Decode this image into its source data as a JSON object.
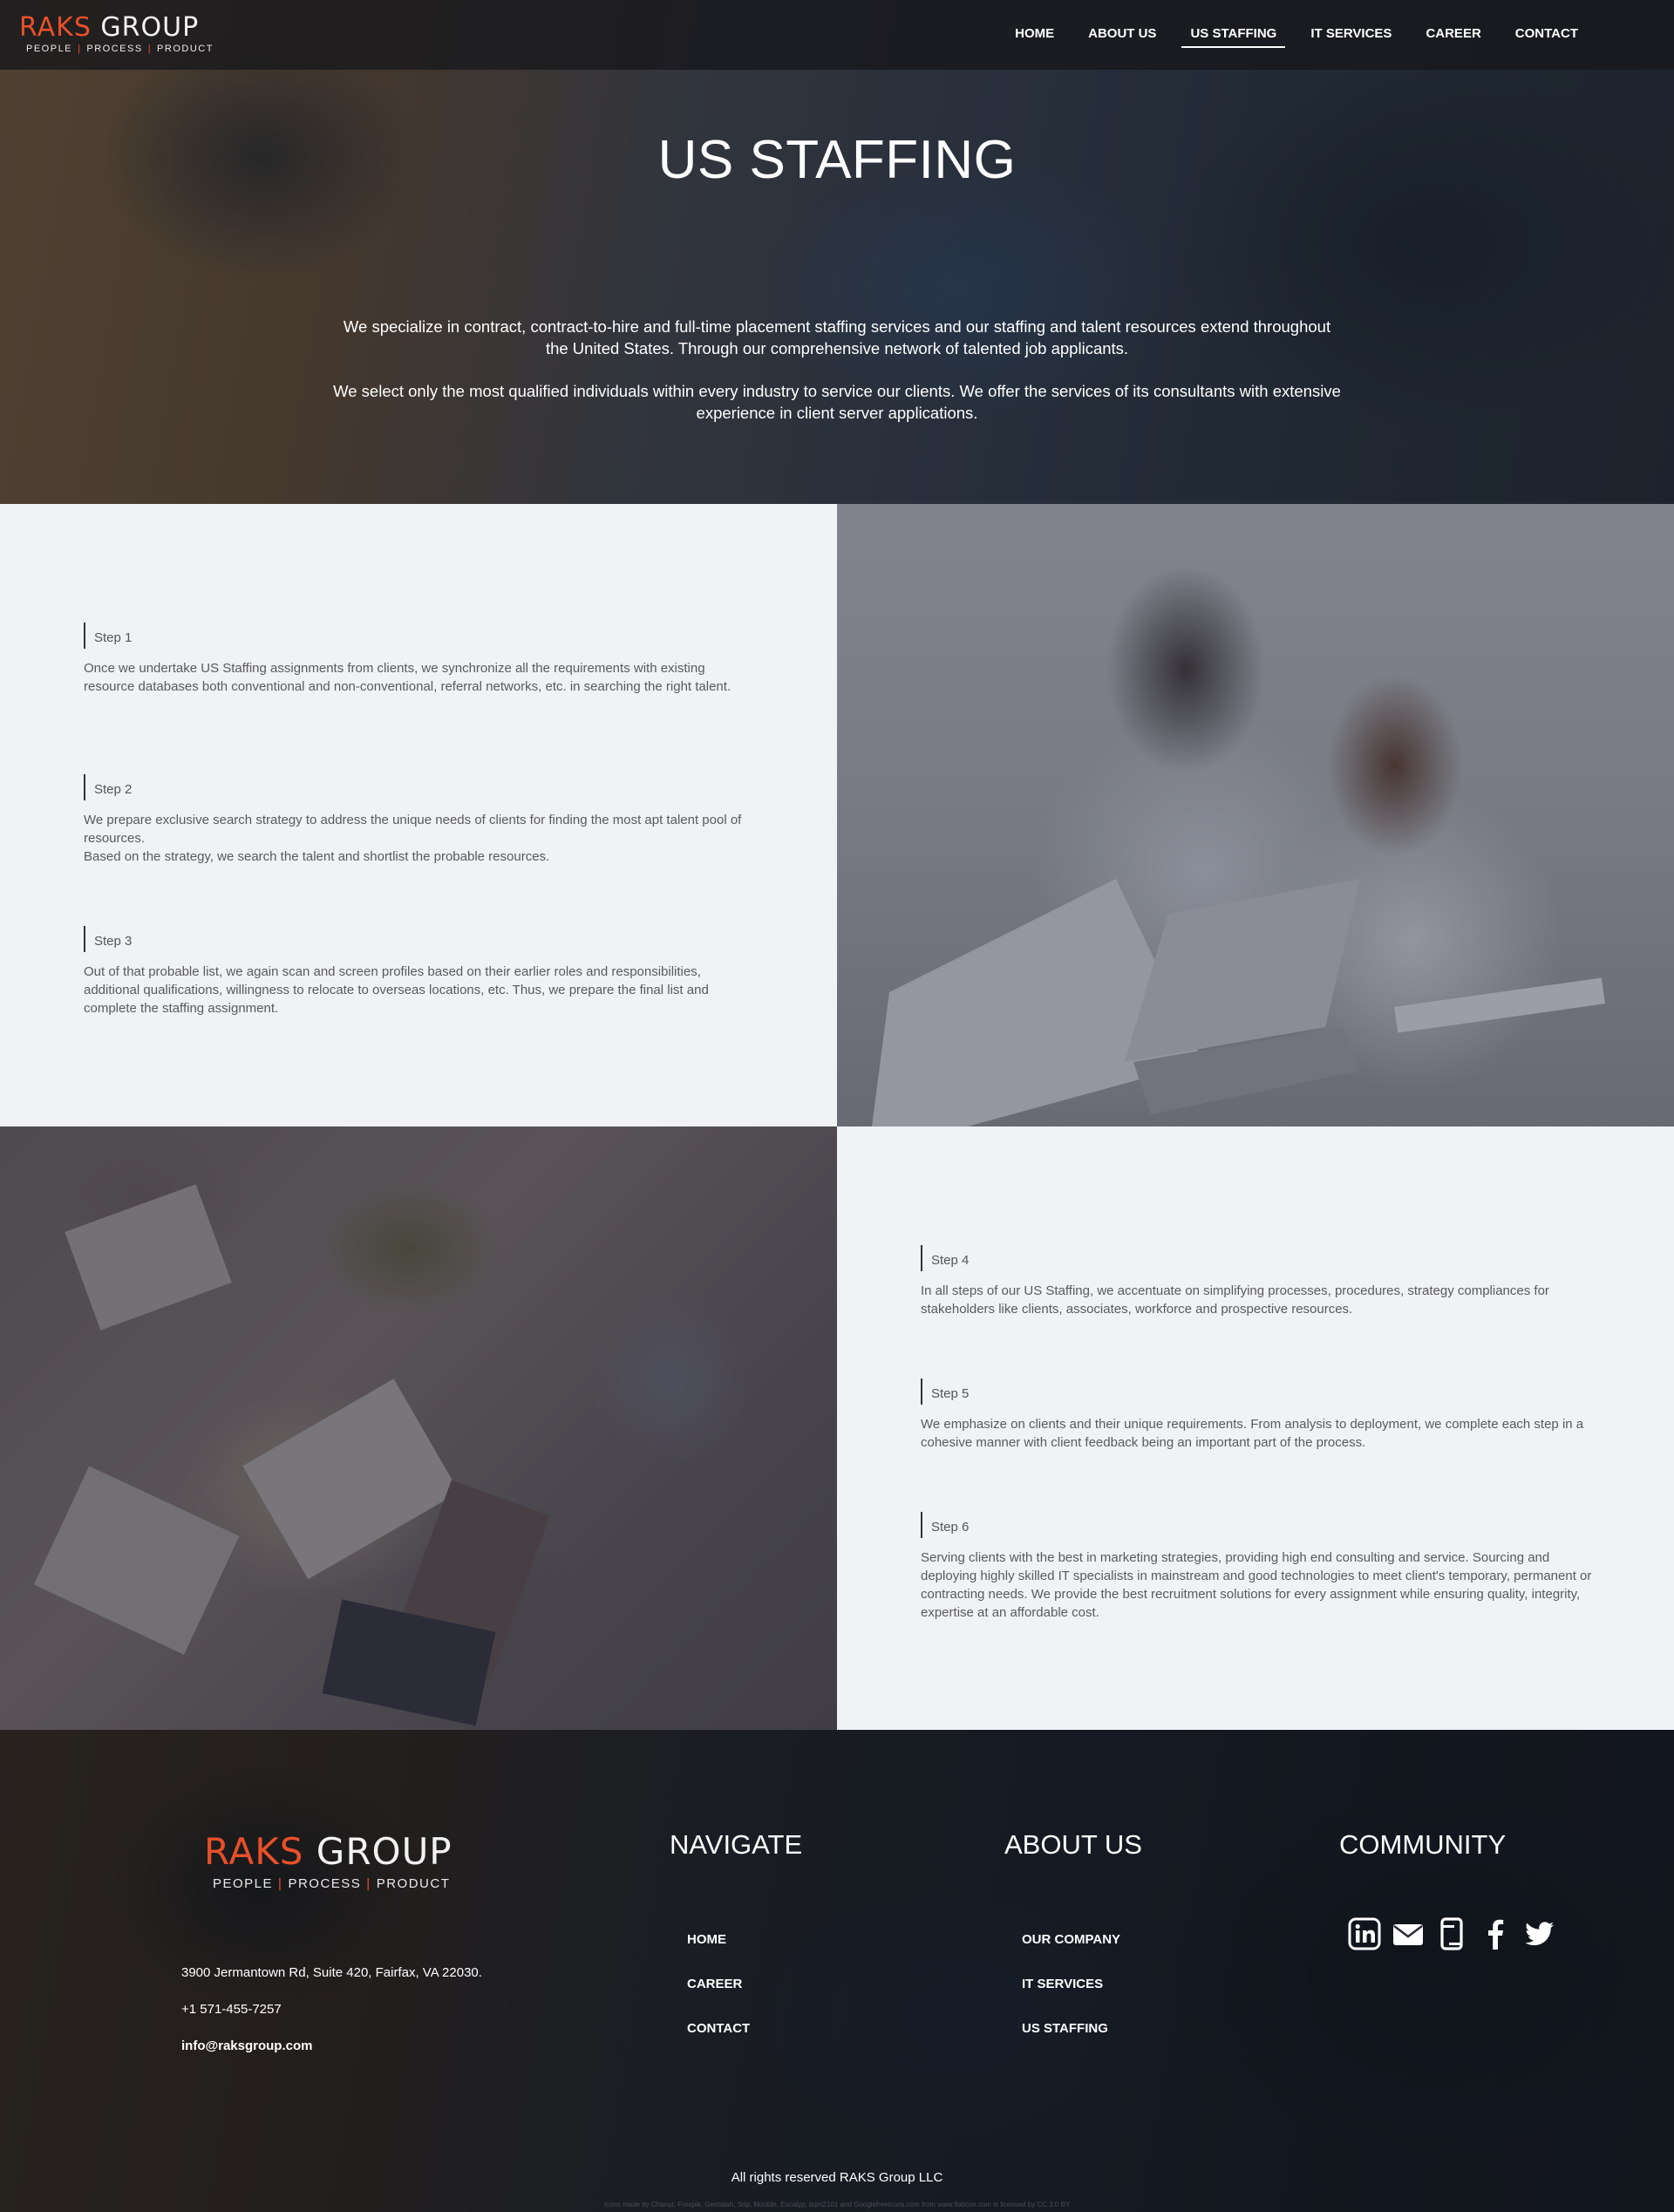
{
  "brand": {
    "name_part1": "RAKS",
    "name_part2": "GROUP",
    "tag_1": "PEOPLE",
    "tag_2": "PROCESS",
    "tag_3": "PRODUCT",
    "accent_color": "#e8502a"
  },
  "nav": {
    "items": [
      {
        "label": "HOME",
        "active": false
      },
      {
        "label": "ABOUT US",
        "active": false
      },
      {
        "label": "US STAFFING",
        "active": true
      },
      {
        "label": "IT SERVICES",
        "active": false
      },
      {
        "label": "CAREER",
        "active": false
      },
      {
        "label": "CONTACT",
        "active": false
      }
    ]
  },
  "hero": {
    "title": "US STAFFING",
    "paragraph_1": "We specialize in contract, contract-to-hire and full-time placement staffing services and our staffing and talent resources extend throughout the United States. Through our comprehensive network of talented job applicants.",
    "paragraph_2": "We select only the most qualified individuals within every industry to service our clients. We offer the services of its consultants with extensive experience in client server applications."
  },
  "steps": [
    {
      "title": "Step 1",
      "text": "Once we undertake US Staffing assignments from clients, we synchronize all the requirements with existing resource databases both conventional and non-conventional, referral networks, etc. in searching the right talent."
    },
    {
      "title": "Step 2",
      "text": "We prepare exclusive search strategy to address the unique needs of clients for finding the most apt talent pool of resources.\nBased on the strategy, we search the talent and shortlist the probable resources."
    },
    {
      "title": "Step 3",
      "text": "Out of that probable list, we again scan and screen profiles based on their earlier roles and responsibilities, additional qualifications, willingness to relocate to overseas locations, etc. Thus, we prepare the final list and complete the staffing assignment."
    },
    {
      "title": "Step 4",
      "text": "In all steps of our US Staffing, we accentuate on simplifying processes, procedures, strategy compliances for stakeholders like clients, associates, workforce and prospective resources."
    },
    {
      "title": "Step 5",
      "text": "We emphasize on clients and their unique requirements. From analysis to deployment, we complete each step in a cohesive manner with client feedback being an important part of the process."
    },
    {
      "title": "Step 6",
      "text": "Serving clients with the best in marketing strategies, providing high end consulting and service. Sourcing and deploying highly skilled IT specialists in mainstream and good technologies to meet client's temporary, permanent or contracting needs. We provide the best recruitment solutions for every assignment while ensuring quality, integrity, expertise at an affordable cost."
    }
  ],
  "footer": {
    "address": "3900 Jermantown Rd, Suite 420, Fairfax, VA 22030.",
    "phone": "+1 571-455-7257",
    "email": "info@raksgroup.com",
    "navigate_heading": "NAVIGATE",
    "navigate_links": [
      "HOME",
      "CAREER",
      "CONTACT"
    ],
    "about_heading": "ABOUT US",
    "about_links": [
      "OUR COMPANY",
      "IT SERVICES",
      "US STAFFING"
    ],
    "community_heading": "COMMUNITY",
    "social_icons": [
      "linkedin-icon",
      "email-icon",
      "mobile-icon",
      "facebook-icon",
      "twitter-icon"
    ],
    "copyright": "All rights reserved RAKS Group LLC",
    "credits": "Icons made by Chanut, Freepik, Geotatah, Srip, Moolde, Eucalyp, bqm2101 and Googlefreeicons.com from www.flaticon.com is licensed by CC 3.0 BY"
  }
}
